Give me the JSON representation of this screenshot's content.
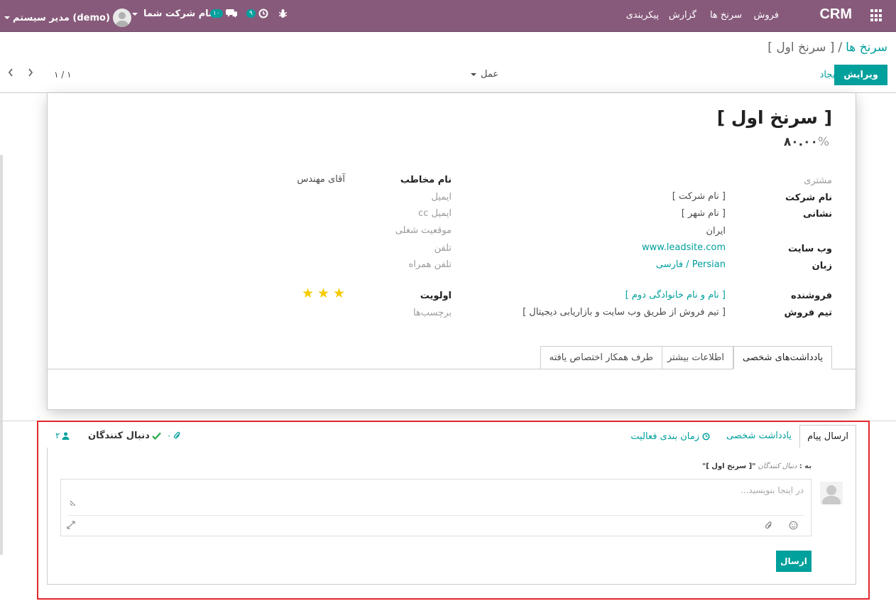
{
  "navbar": {
    "brand": "CRM",
    "menus": [
      "فروش",
      "سرنخ ها",
      "گزارش",
      "پیکربندی"
    ],
    "user": "مدیر سیستم (demo)",
    "company": "نام شرکت شما",
    "messages_count": "۱۰",
    "activities_count": "۹"
  },
  "breadcrumb": {
    "parent": "سرنخ ها",
    "separator": "/",
    "current": "[ سرنخ اول ]"
  },
  "buttons": {
    "edit": "ویرایش",
    "create": "ایجاد",
    "action": "عمل",
    "send": "ارسال"
  },
  "pager": {
    "value": "۱ / ۱"
  },
  "lead": {
    "title": "[ سرنخ اول ]",
    "probability": "۸۰.۰۰",
    "probability_unit": "%",
    "left_fields": [
      {
        "label": "مشتری",
        "value": ""
      },
      {
        "label": "نام شرکت",
        "value": "[ نام شرکت ]"
      },
      {
        "label": "نشانی",
        "value": "[ نام شهر ]"
      },
      {
        "label": "",
        "value": "ایران"
      },
      {
        "label": "وب سایت",
        "value": "www.leadsite.com"
      },
      {
        "label": "زبان",
        "value": "Persian / فارسی"
      },
      {
        "label": "فروشنده",
        "value": "[ نام و نام خانوادگی دوم ]"
      },
      {
        "label": "تیم فروش",
        "value": "[ تیم فروش از طریق وب سایت و بازاریابی دیجیتال ]"
      }
    ],
    "right_fields": [
      {
        "label": "نام مخاطب",
        "value": "آقای مهندس"
      },
      {
        "label": "ایمیل",
        "value": ""
      },
      {
        "label": "ایمیل cc",
        "value": ""
      },
      {
        "label": "موقعیت شغلی",
        "value": ""
      },
      {
        "label": "تلفن",
        "value": ""
      },
      {
        "label": "تلفن همراه",
        "value": ""
      },
      {
        "label": "اولویت",
        "value": ""
      },
      {
        "label": "برچسب‌ها",
        "value": ""
      }
    ],
    "priority_stars": 3,
    "priority_color": "#f3cc00"
  },
  "form_tabs": [
    "یادداشت‌های شخصی",
    "اطلاعات بیشتر",
    "طرف همکار اختصاص یافته"
  ],
  "chatter": {
    "tabs": [
      "ارسال پیام",
      "یادداشت شخصی",
      "زمان بندی فعالیت"
    ],
    "followers_label": "دنبال کنندگان",
    "attachments_count": "۰",
    "followers_count": "۲",
    "to_prefix": "به :",
    "to_recipients": "دنبال کنندگان",
    "to_document": "\"[ سرنخ اول ]\"",
    "placeholder": "در اینجا بنویسید..."
  },
  "colors": {
    "navbar": "#875a7b",
    "accent": "#00a09d",
    "highlight_frame": "#e3262c"
  }
}
